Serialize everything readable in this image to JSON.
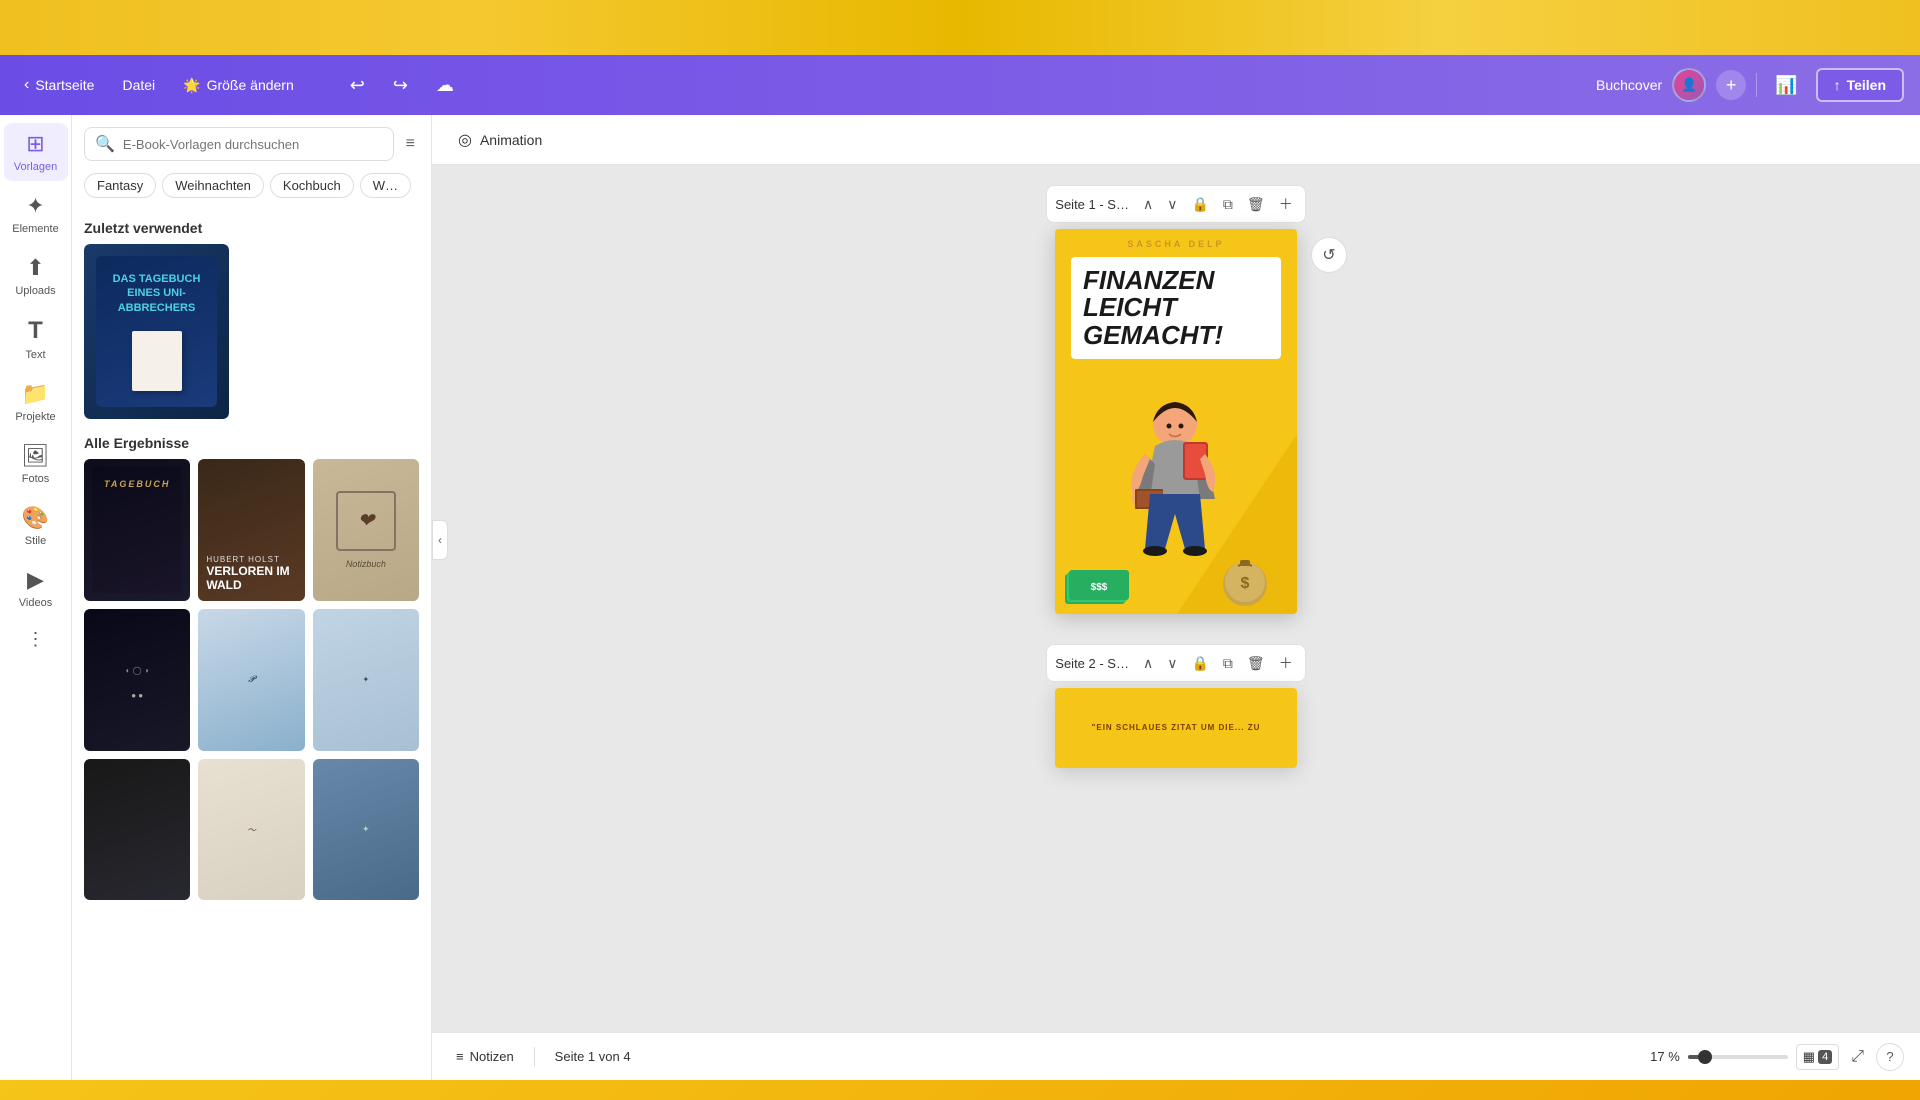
{
  "topBar": {
    "background": "#f5c518"
  },
  "header": {
    "home_label": "Startseite",
    "file_label": "Datei",
    "size_label": "Größe ändern",
    "size_icon": "🌟",
    "undo_icon": "↩",
    "redo_icon": "↪",
    "save_icon": "☁",
    "buchcover_label": "Buchcover",
    "add_label": "+",
    "analytics_icon": "📊",
    "share_label": "Teilen",
    "share_icon": "↑"
  },
  "sidebar": {
    "items": [
      {
        "label": "Vorlagen",
        "icon": "⊞",
        "active": true
      },
      {
        "label": "Elemente",
        "icon": "✦",
        "active": false
      },
      {
        "label": "Uploads",
        "icon": "⬆",
        "active": false
      },
      {
        "label": "Text",
        "icon": "T",
        "active": false
      },
      {
        "label": "Projekte",
        "icon": "📁",
        "active": false
      },
      {
        "label": "Fotos",
        "icon": "🖼",
        "active": false
      },
      {
        "label": "Stile",
        "icon": "🎨",
        "active": false
      },
      {
        "label": "Videos",
        "icon": "▶",
        "active": false
      },
      {
        "label": "More",
        "icon": "⋮⋮",
        "active": false
      }
    ]
  },
  "searchBar": {
    "placeholder": "E-Book-Vorlagen durchsuchen",
    "filter_icon": "≡"
  },
  "tags": [
    "Fantasy",
    "Weihnachten",
    "Kochbuch",
    "W…"
  ],
  "recentlyUsed": {
    "title": "Zuletzt verwendet",
    "thumbnail_text": "DAS TAGEBUCH EINES UNI-ABBRECHERS"
  },
  "allResults": {
    "title": "Alle Ergebnisse"
  },
  "animation": {
    "label": "Animation",
    "icon": "◎"
  },
  "canvas": {
    "page1": {
      "label": "Seite 1 - S…",
      "author": "SASCHA DELP",
      "title_line1": "FINANZEN",
      "title_line2": "LEICHT",
      "title_line3": "GEMACHT!",
      "refresh_icon": "↺"
    },
    "page2": {
      "label": "Seite 2 - S…",
      "preview_text": "\"EIN SCHLAUES ZITAT UM DIE... ZU"
    }
  },
  "bottomBar": {
    "notes_label": "Notizen",
    "notes_icon": "≡",
    "page_info": "Seite 1 von 4",
    "zoom_percent": "17 %",
    "zoom_value": 17,
    "grid_icon": "▦",
    "expand_icon": "⤢",
    "help_icon": "?"
  },
  "icons": {
    "back_arrow": "‹",
    "chevron_down": "⌄",
    "chevron_up": "⌃",
    "lock": "🔒",
    "copy": "⧉",
    "trash": "🗑",
    "add_page": "＋",
    "hide_panel": "‹"
  }
}
